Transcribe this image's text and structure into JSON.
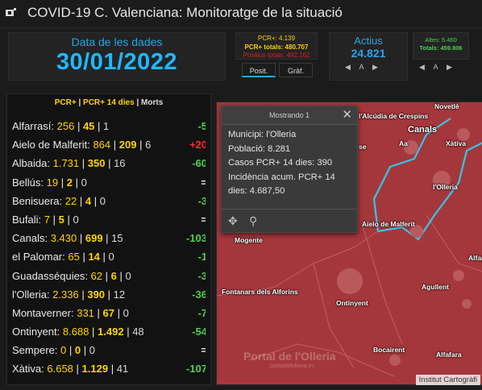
{
  "header": {
    "title": "COVID-19 C. Valenciana: Monitoratge de la situació"
  },
  "date_card": {
    "label": "Data de les dades",
    "value": "30/01/2022"
  },
  "pcr_card": {
    "line1": "PCR+: 4.139",
    "line2": "PCR+ totals: 480.707",
    "line3": "Positius totals: 492.162"
  },
  "tabs": {
    "positius": "Posit.",
    "grafic": "Gràf."
  },
  "actius_card": {
    "label": "Actius",
    "value": "24.821",
    "nav_label": "A"
  },
  "altes_card": {
    "line1": "Altes: 5.460",
    "line2": "Totals: 459.806",
    "nav_label": "A"
  },
  "list": {
    "header": {
      "pcr": "PCR+",
      "sep1": " | ",
      "pcr14": "PCR+ 14 dies",
      "sep2": " | ",
      "morts": "Morts"
    },
    "rows": [
      {
        "name": "Alfarrasí:",
        "pcr": "256",
        "pcr14": "45",
        "morts": "1",
        "delta": "-5",
        "kind": "pos"
      },
      {
        "name": "Aielo de Malferit:",
        "pcr": "864",
        "pcr14": "209",
        "morts": "6",
        "delta": "+20",
        "kind": "neg"
      },
      {
        "name": "Albaida:",
        "pcr": "1.731",
        "pcr14": "350",
        "morts": "16",
        "delta": "-60",
        "kind": "pos"
      },
      {
        "name": "Bellús:",
        "pcr": "19",
        "pcr14": "2",
        "morts": "0",
        "delta": "=",
        "kind": "eq"
      },
      {
        "name": "Benisuera:",
        "pcr": "22",
        "pcr14": "4",
        "morts": "0",
        "delta": "-3",
        "kind": "pos"
      },
      {
        "name": "Bufali:",
        "pcr": "7",
        "pcr14": "5",
        "morts": "0",
        "delta": "=",
        "kind": "eq"
      },
      {
        "name": "Canals:",
        "pcr": "3.430",
        "pcr14": "699",
        "morts": "15",
        "delta": "-103",
        "kind": "pos"
      },
      {
        "name": "el Palomar:",
        "pcr": "65",
        "pcr14": "14",
        "morts": "0",
        "delta": "-1",
        "kind": "pos"
      },
      {
        "name": "Guadasséquies:",
        "pcr": "62",
        "pcr14": "6",
        "morts": "0",
        "delta": "-3",
        "kind": "pos"
      },
      {
        "name": "l'Olleria:",
        "pcr": "2.336",
        "pcr14": "390",
        "morts": "12",
        "delta": "-36",
        "kind": "pos"
      },
      {
        "name": "Montaverner:",
        "pcr": "331",
        "pcr14": "67",
        "morts": "0",
        "delta": "-7",
        "kind": "pos"
      },
      {
        "name": "Ontinyent:",
        "pcr": "8.688",
        "pcr14": "1.492",
        "morts": "48",
        "delta": "-54",
        "kind": "pos"
      },
      {
        "name": "Sempere:",
        "pcr": "0",
        "pcr14": "0",
        "morts": "0",
        "delta": "=",
        "kind": "eq"
      },
      {
        "name": "Xàtiva:",
        "pcr": "6.658",
        "pcr14": "1.129",
        "morts": "41",
        "delta": "-107",
        "kind": "pos"
      }
    ]
  },
  "popup": {
    "title": "Mostrando 1",
    "municipi": "Municipi: l'Olleria",
    "poblacio": "Població: 8.281",
    "casos": "Casos PCR+ 14 dies: 390",
    "incidencia1": "Incidència acum. PCR+ 14",
    "incidencia2": "dies: 4.687,50"
  },
  "map": {
    "labels": {
      "novetle": "Novetlè",
      "alcudia": "l'Alcúdia de Crespins",
      "canals": "Canals",
      "xativa": "Xàtiva",
      "olleria": "l'Olleria",
      "aielo": "Aielo de Malferit",
      "alfarrasi": "Alfarrasí",
      "mogente": "Mogente",
      "aguilent": "Agullent",
      "fontanars": "Fontanars dels Alforins",
      "ontinyent": "Ontinyent",
      "bocairent": "Bocairent",
      "alfafara": "Alfafara",
      "aa": "Aa",
      "se": "se"
    },
    "watermark": "Portal de l'Olleria",
    "watermark_sub": "portaldelolleria.es",
    "attribution": "Institut Cartogràfi"
  },
  "colors": {
    "accent": "#2aa3e8",
    "pcr_yellow": "#ffd400",
    "down_green": "#4dd24d",
    "up_red": "#ff2a2a",
    "map_fill": "#a4373c"
  }
}
